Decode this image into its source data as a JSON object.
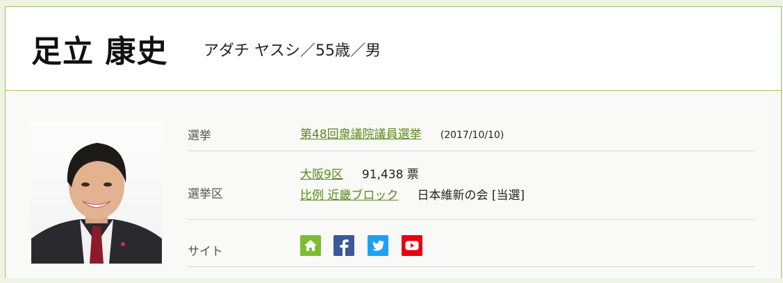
{
  "candidate": {
    "name": "足立 康史",
    "reading_age_gender": "アダチ ヤスシ／55歳／男"
  },
  "rows": {
    "election": {
      "label": "選挙",
      "link": "第48回衆議院議員選挙",
      "date": "(2017/10/10)"
    },
    "district": {
      "label": "選挙区",
      "district_link": "大阪9区",
      "votes": "91,438 票",
      "pr_link": "比例 近畿ブロック",
      "party_status": "日本維新の会 [当選]"
    },
    "site": {
      "label": "サイト",
      "icons": [
        "home-icon",
        "facebook-icon",
        "twitter-icon",
        "youtube-icon"
      ]
    }
  },
  "colors": {
    "accent_green": "#5a8a1a",
    "border_green": "#9bc46a",
    "home": "#7cbd32",
    "facebook": "#3b5998",
    "twitter": "#1da1f2",
    "youtube": "#e60012"
  }
}
